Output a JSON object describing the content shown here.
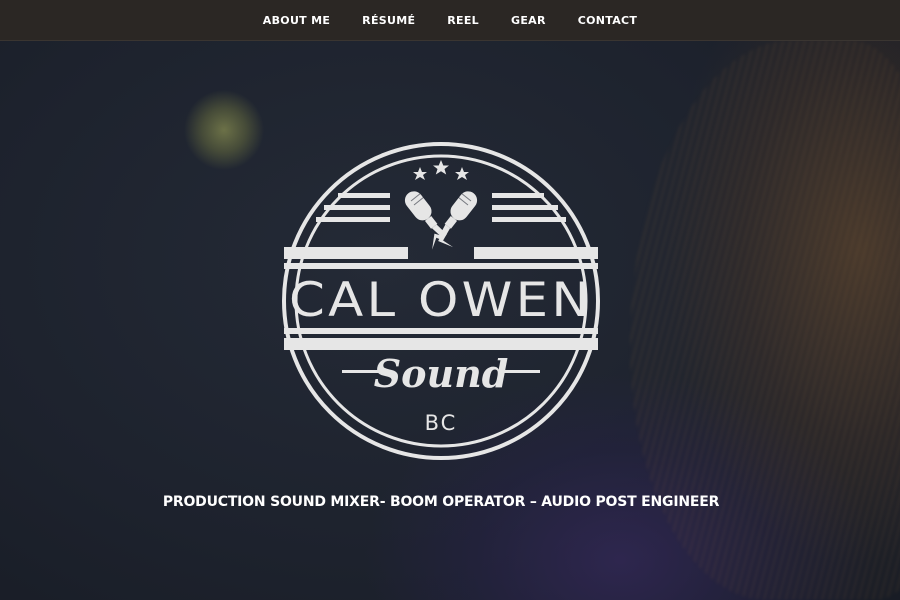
{
  "nav": {
    "items": [
      {
        "label": "ABOUT ME"
      },
      {
        "label": "RÉSUMÉ"
      },
      {
        "label": "REEL"
      },
      {
        "label": "GEAR"
      },
      {
        "label": "CONTACT"
      }
    ]
  },
  "logo": {
    "name": "CAL OWEN",
    "script": "Sound",
    "region": "BC",
    "icon": "crossed-microphones-icon",
    "color": "#e6e6e6"
  },
  "tagline": "PRODUCTION SOUND MIXER- BOOM OPERATOR – AUDIO POST ENGINEER",
  "colors": {
    "navbar_bg": "#2b2724",
    "text": "#ffffff",
    "background": "#1d222d"
  }
}
